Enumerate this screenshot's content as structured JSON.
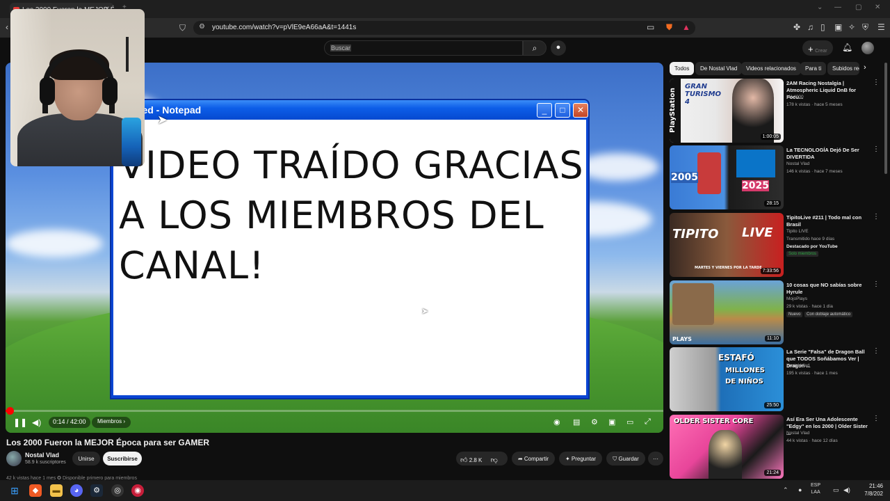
{
  "browser": {
    "tab_title": "Los 2000 Fueron la MEJOR É",
    "url": "youtube.com/watch?v=pVlE9eA66aA&t=1441s"
  },
  "youtube": {
    "search_placeholder": "Buscar",
    "create_label": "Crear"
  },
  "player": {
    "notepad_title": "Untitled - Notepad",
    "notepad_title_visible": "itled - Notepad",
    "notepad_text": "VIDEO TRAÍDO GRACIAS A LOS MIEMBROS DEL CANAL!",
    "time": "0:14 / 42:00",
    "members_label": "Miembros",
    "progress_fraction": 0.0056
  },
  "video": {
    "title": "Los 2000 Fueron la MEJOR Época para ser GAMER",
    "channel": "Nostal Vlad",
    "subscribers": "58.9 k suscriptores",
    "join_label": "Unirse",
    "subscribe_label": "Suscribirse",
    "likes": "2.8 K",
    "share_label": "Compartir",
    "ask_label": "Preguntar",
    "save_label": "Guardar",
    "description_peek": "42 k vistas  hace 1 mes  ✪ Disponible primero para miembros"
  },
  "sidebar": {
    "chips": [
      "Todos",
      "De Nostal Vlad",
      "Videos relacionados",
      "Para ti",
      "Subidos rec"
    ],
    "recommendations": [
      {
        "title": "2AM Racing Nostalgia | Atmospheric Liquid DnB for Focu...",
        "channel": "Mik4000",
        "meta": "178 k vistas · hace 5 meses",
        "duration": "1:00:05",
        "thumb_text": "GRAN TURISMO 4",
        "side_text": "PlayStation"
      },
      {
        "title": "La TECNOLOGÍA Dejó De Ser DIVERTIDA",
        "channel": "Nostal Vlad",
        "meta": "146 k vistas · hace 7 meses",
        "duration": "28:15",
        "thumb_text_a": "2005",
        "thumb_text_b": "2025"
      },
      {
        "title": "TipitoLive #211 | Todo mal con Brasil",
        "channel": "Tipito LIVE",
        "meta": "Transmitido hace 9 días",
        "extra": "Destacado por YouTube",
        "badge": "Solo miembros",
        "duration": "7:33:56",
        "thumb_text_a": "TIPITO",
        "thumb_text_b": "LIVE",
        "thumb_sub_a": "MARTES Y VIERNES",
        "thumb_sub_b": "POR LA TARDE"
      },
      {
        "title": "10 cosas que NO sabías sobre Hyrule",
        "channel": "MojoPlays",
        "meta": "29 k vistas · hace 1 día",
        "badge": "Nuevo",
        "badge2": "Con doblaje automático",
        "duration": "11:10",
        "thumb_text": "PLAYS"
      },
      {
        "title": "La Serie \"Falsa\" de Dragon Ball que TODOS Soñábamos Ver | Dragon ...",
        "channel": "Nostal Vlad",
        "meta": "195 k vistas · hace 1 mes",
        "duration": "25:50",
        "thumb_text_a": "ESTAFÓ",
        "thumb_text_b": "MILLONES",
        "thumb_text_c": "DE NIÑOS"
      },
      {
        "title": "Así Era Ser Una Adolescente \"Edgy\" en los 2000 | Older Sister ...",
        "channel": "Nostal Vlad",
        "meta": "44 k vistas · hace 12 días",
        "duration": "21:24",
        "thumb_text": "OLDER SISTER CORE"
      }
    ]
  },
  "taskbar": {
    "lang_a": "ESP",
    "lang_b": "LAA",
    "time": "21:46",
    "date": "7/8/202"
  },
  "colors": {
    "yt_red": "#ff0000",
    "xp_blue": "#0a46d4",
    "xp_close": "#c24426"
  }
}
